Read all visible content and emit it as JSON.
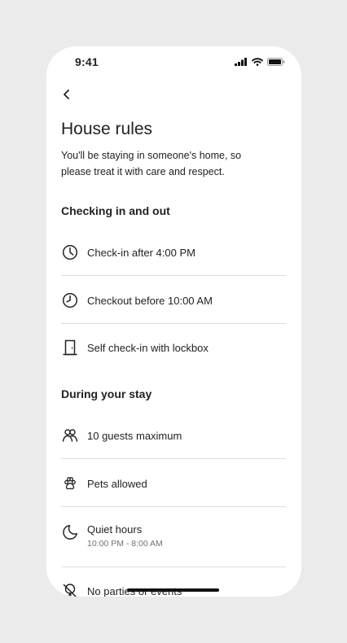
{
  "status_bar": {
    "time": "9:41"
  },
  "header": {
    "back_icon": "chevron-left-icon"
  },
  "page": {
    "title": "House rules",
    "intro": "You'll be staying in someone's home, so please treat it with care and respect."
  },
  "sections": [
    {
      "title": "Checking in and out",
      "rules": [
        {
          "icon": "clock-icon",
          "label": "Check-in after 4:00 PM"
        },
        {
          "icon": "clock-icon",
          "label": "Checkout before 10:00 AM"
        },
        {
          "icon": "door-icon",
          "label": "Self check-in with lockbox"
        }
      ]
    },
    {
      "title": "During your stay",
      "rules": [
        {
          "icon": "guests-icon",
          "label": "10 guests maximum"
        },
        {
          "icon": "paw-icon",
          "label": "Pets allowed"
        },
        {
          "icon": "moon-icon",
          "label": "Quiet hours",
          "detail": "10:00 PM - 8:00 AM"
        },
        {
          "icon": "no-party-icon",
          "label": "No parties or events"
        }
      ]
    }
  ]
}
